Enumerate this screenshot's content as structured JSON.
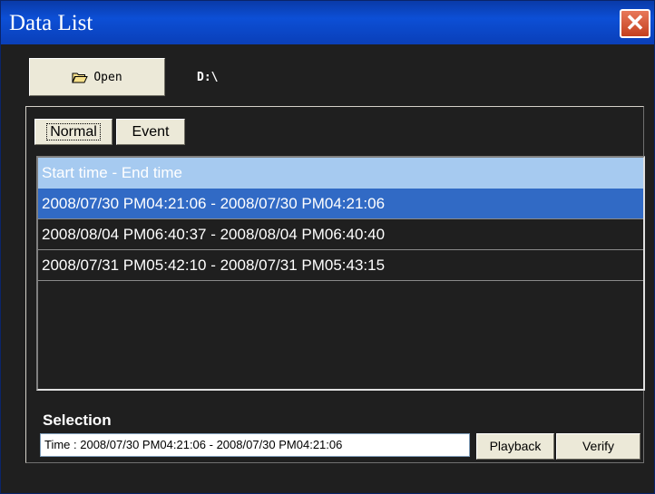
{
  "window": {
    "title": "Data List",
    "close_glyph": "✕"
  },
  "toolbar": {
    "open_label": "Open",
    "path": "D:\\"
  },
  "tabs": [
    {
      "label": "Normal",
      "active": true
    },
    {
      "label": "Event",
      "active": false
    }
  ],
  "list": {
    "header": "Start time - End time",
    "rows": [
      "2008/07/30 PM04:21:06 - 2008/07/30 PM04:21:06",
      "2008/08/04 PM06:40:37 - 2008/08/04 PM06:40:40",
      "2008/07/31 PM05:42:10 - 2008/07/31 PM05:43:15"
    ],
    "selected_index": 0
  },
  "selection": {
    "label": "Selection",
    "value": "Time : 2008/07/30 PM04:21:06 - 2008/07/30 PM04:21:06"
  },
  "buttons": {
    "playback": "Playback",
    "verify": "Verify"
  },
  "colors": {
    "title_bar": "#0c4fd6",
    "selected_row": "#316ac5",
    "header": "#a6caf0",
    "background": "#1f1f1f"
  }
}
